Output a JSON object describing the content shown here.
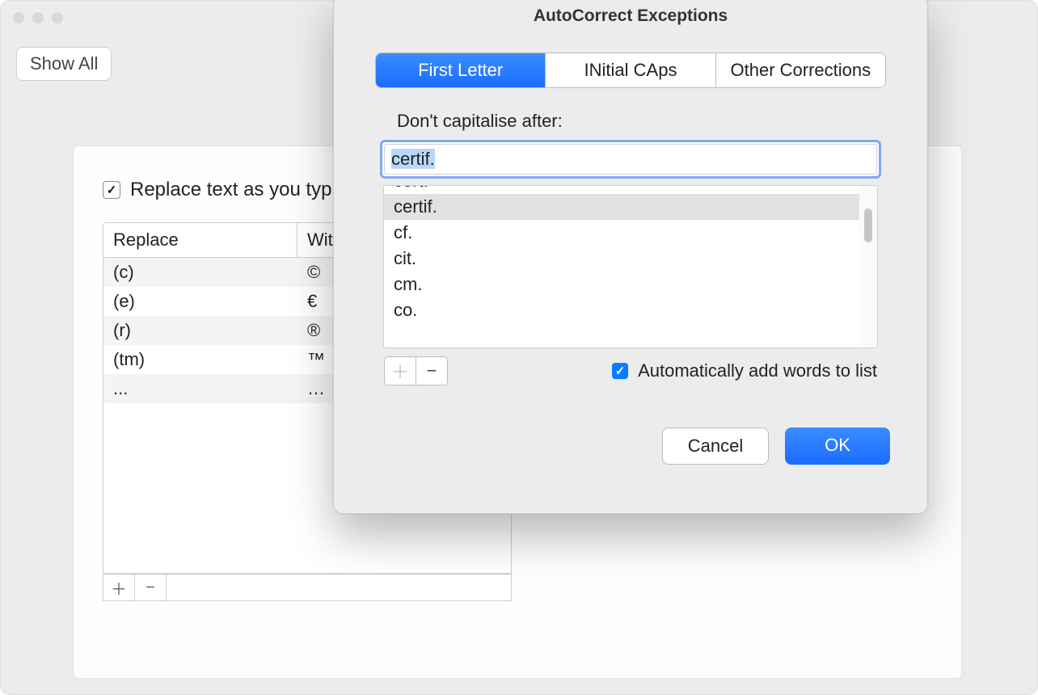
{
  "parent": {
    "show_all_label": "Show All",
    "replace_checkbox_label": "Replace text as you typ",
    "replace_checkbox_checked": true,
    "table": {
      "headers": {
        "replace": "Replace",
        "with": "With"
      },
      "rows": [
        {
          "replace": "(c)",
          "with": "©"
        },
        {
          "replace": "(e)",
          "with": "€"
        },
        {
          "replace": "(r)",
          "with": "®"
        },
        {
          "replace": "(tm)",
          "with": "™"
        },
        {
          "replace": "...",
          "with": "…"
        }
      ]
    }
  },
  "dialog": {
    "title": "AutoCorrect Exceptions",
    "tabs": [
      {
        "label": "First Letter",
        "active": true
      },
      {
        "label": "INitial CAps",
        "active": false
      },
      {
        "label": "Other Corrections",
        "active": false
      }
    ],
    "section_label": "Don't capitalise after:",
    "input_value": "certif.",
    "list_items": [
      {
        "label": "cert.",
        "cut": true,
        "selected": false
      },
      {
        "label": "certif.",
        "cut": false,
        "selected": true
      },
      {
        "label": "cf.",
        "cut": false,
        "selected": false
      },
      {
        "label": "cit.",
        "cut": false,
        "selected": false
      },
      {
        "label": "cm.",
        "cut": false,
        "selected": false
      },
      {
        "label": "co.",
        "cut": false,
        "selected": false
      }
    ],
    "auto_add_label": "Automatically add words to list",
    "auto_add_checked": true,
    "buttons": {
      "cancel": "Cancel",
      "ok": "OK"
    }
  }
}
